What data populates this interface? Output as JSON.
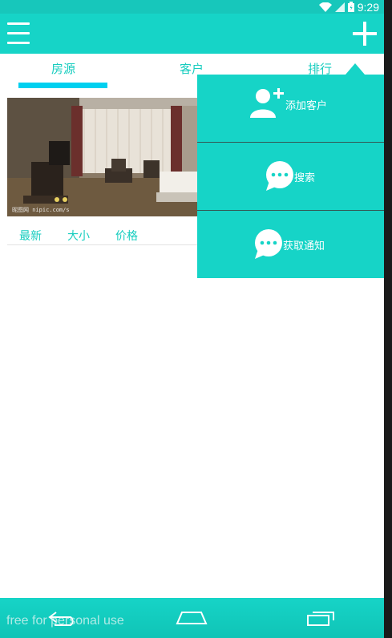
{
  "status_bar": {
    "time": "9:29",
    "icons": [
      "wifi-icon",
      "signal-icon",
      "battery-icon"
    ]
  },
  "app_bar": {
    "menu_icon": "hamburger-menu-icon",
    "add_icon": "plus-icon"
  },
  "tabs": [
    {
      "label": "房源",
      "selected": true
    },
    {
      "label": "客户",
      "selected": false
    },
    {
      "label": "排行",
      "selected": false
    }
  ],
  "listing": {
    "photo_caption": "昵图网 nipic.com/s",
    "sort_options": [
      "最新",
      "大小",
      "价格"
    ]
  },
  "popup_menu": {
    "items": [
      {
        "label": "添加客户",
        "icon": "add-user-icon"
      },
      {
        "label": "搜索",
        "icon": "chat-bubble-icon"
      },
      {
        "label": "获取通知",
        "icon": "chat-bubble-icon"
      }
    ]
  },
  "nav_bar": {
    "icons": [
      "back-icon",
      "home-icon",
      "recent-apps-icon"
    ]
  },
  "watermark": "free for personal use",
  "colors": {
    "primary": "#16d4c7",
    "tab_indicator": "#00d0f0",
    "text_accent": "#17cdbf"
  }
}
